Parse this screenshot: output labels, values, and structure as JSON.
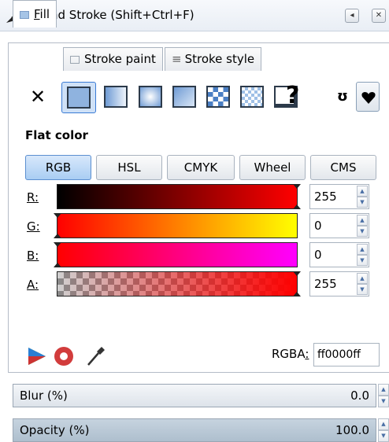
{
  "window": {
    "title": "Fill and Stroke (Shift+Ctrl+F)"
  },
  "tabs": [
    {
      "label": "Fill",
      "mnemonic": "F",
      "rest": "ill",
      "active": true
    },
    {
      "label": "Stroke paint",
      "active": false
    },
    {
      "label": "Stroke style",
      "active": false
    }
  ],
  "paint_types": [
    "no-paint",
    "flat-color",
    "linear-gradient",
    "radial-gradient",
    "mesh-gradient",
    "pattern",
    "swatch",
    "unset"
  ],
  "flat_color_label": "Flat color",
  "modes": [
    "RGB",
    "HSL",
    "CMYK",
    "Wheel",
    "CMS"
  ],
  "active_mode": "RGB",
  "channels": [
    {
      "mnemonic": "R",
      "label": "R:",
      "value": "255"
    },
    {
      "mnemonic": "G",
      "label": "G:",
      "value": "0"
    },
    {
      "mnemonic": "B",
      "label": "B:",
      "value": "0"
    },
    {
      "mnemonic": "A",
      "label": "A:",
      "value": "255"
    }
  ],
  "rgba": {
    "label": "RGBA",
    "label_suffix": ":",
    "value": "ff0000ff"
  },
  "blur": {
    "label": "Blur (%)",
    "value": "0.0"
  },
  "opacity": {
    "label": "Opacity (%)",
    "value": "100.0"
  },
  "colors": {
    "accent": "#3a7bd5",
    "current": "#ff0000"
  }
}
